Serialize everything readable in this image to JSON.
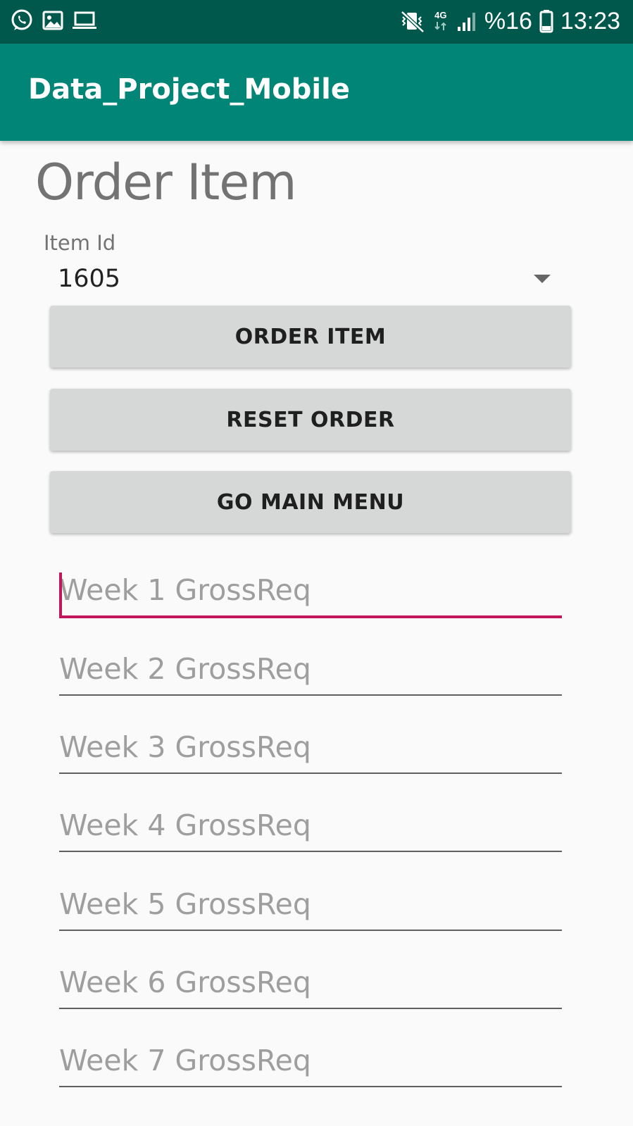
{
  "status_bar": {
    "icons_left": [
      "whatsapp-icon",
      "image-icon",
      "laptop-icon"
    ],
    "icons_right": [
      "vibrate-icon",
      "network-4g-icon",
      "signal-icon",
      "battery-icon"
    ],
    "network_type": "4G",
    "battery_percent": "%16",
    "time": "13:23",
    "background": "#00574b"
  },
  "app_bar": {
    "title": "Data_Project_Mobile",
    "background": "#008577"
  },
  "main": {
    "heading": "Order Item",
    "item_id": {
      "label": "Item Id",
      "selected": "1605"
    },
    "buttons": {
      "order_item": "ORDER ITEM",
      "reset_order": "RESET ORDER",
      "go_main_menu": "GO MAIN MENU"
    },
    "week_fields": [
      {
        "placeholder": "Week 1 GrossReq",
        "value": ""
      },
      {
        "placeholder": "Week 2 GrossReq",
        "value": ""
      },
      {
        "placeholder": "Week 3 GrossReq",
        "value": ""
      },
      {
        "placeholder": "Week 4 GrossReq",
        "value": ""
      },
      {
        "placeholder": "Week 5 GrossReq",
        "value": ""
      },
      {
        "placeholder": "Week 6 GrossReq",
        "value": ""
      },
      {
        "placeholder": "Week 7 GrossReq",
        "value": ""
      }
    ],
    "focus_accent": "#c2185b"
  }
}
